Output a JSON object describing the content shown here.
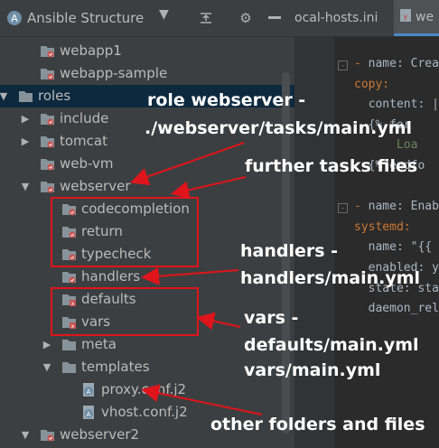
{
  "panel": {
    "title": "Ansible Structure",
    "icons": [
      "ansible-icon",
      "chevron-down-icon",
      "collapse-all-icon",
      "gear-icon",
      "minimize-icon"
    ]
  },
  "tree": [
    {
      "label": "webapp1",
      "depth": 1,
      "arrow": "",
      "icon": "role"
    },
    {
      "label": "webapp-sample",
      "depth": 1,
      "arrow": "",
      "icon": "role"
    },
    {
      "label": "roles",
      "depth": 0,
      "arrow": "down",
      "icon": "folder",
      "selected": true
    },
    {
      "label": "include",
      "depth": 1,
      "arrow": "right",
      "icon": "role"
    },
    {
      "label": "tomcat",
      "depth": 1,
      "arrow": "right",
      "icon": "role"
    },
    {
      "label": "web-vm",
      "depth": 1,
      "arrow": "",
      "icon": "role"
    },
    {
      "label": "webserver",
      "depth": 1,
      "arrow": "down",
      "icon": "role"
    },
    {
      "label": "codecompletion",
      "depth": 2,
      "arrow": "",
      "icon": "task"
    },
    {
      "label": "return",
      "depth": 2,
      "arrow": "",
      "icon": "task"
    },
    {
      "label": "typecheck",
      "depth": 2,
      "arrow": "",
      "icon": "task"
    },
    {
      "label": "handlers",
      "depth": 2,
      "arrow": "",
      "icon": "task"
    },
    {
      "label": "defaults",
      "depth": 2,
      "arrow": "",
      "icon": "vars"
    },
    {
      "label": "vars",
      "depth": 2,
      "arrow": "",
      "icon": "vars"
    },
    {
      "label": "meta",
      "depth": 2,
      "arrow": "right",
      "icon": "folder"
    },
    {
      "label": "templates",
      "depth": 2,
      "arrow": "down",
      "icon": "folder"
    },
    {
      "label": "proxy.conf.j2",
      "depth": 3,
      "arrow": "",
      "icon": "ansible"
    },
    {
      "label": "vhost.conf.j2",
      "depth": 3,
      "arrow": "",
      "icon": "ansible"
    },
    {
      "label": "webserver2",
      "depth": 1,
      "arrow": "down",
      "icon": "role"
    }
  ],
  "tabs": [
    {
      "label": "ocal-hosts.ini",
      "active": false
    },
    {
      "label": "we",
      "active": true
    }
  ],
  "code": [
    {
      "kind": "plain",
      "parts": [
        [
          "k",
          "- "
        ],
        [
          "p",
          "name: Create"
        ]
      ]
    },
    {
      "kind": "plain",
      "parts": [
        [
          "k",
          "copy:"
        ]
      ]
    },
    {
      "kind": "plain",
      "parts": [
        [
          "p",
          "  content: |"
        ]
      ]
    },
    {
      "kind": "plain",
      "parts": [
        [
          "p",
          "  {% for "
        ]
      ]
    },
    {
      "kind": "plain",
      "parts": [
        [
          "s",
          "      Loa"
        ]
      ]
    },
    {
      "kind": "plain",
      "parts": [
        [
          "p",
          "  {% endfo"
        ]
      ]
    },
    {
      "kind": "plain",
      "parts": [
        [
          "p",
          ""
        ]
      ]
    },
    {
      "kind": "plain",
      "parts": [
        [
          "k",
          "- "
        ],
        [
          "p",
          "name: Enable"
        ]
      ]
    },
    {
      "kind": "plain",
      "parts": [
        [
          "k",
          "systemd:"
        ]
      ]
    },
    {
      "kind": "plain",
      "parts": [
        [
          "p",
          "  name: \"{{ "
        ]
      ]
    },
    {
      "kind": "plain",
      "parts": [
        [
          "p",
          "  enabled: y"
        ]
      ]
    },
    {
      "kind": "plain",
      "parts": [
        [
          "p",
          "  state: sta"
        ]
      ]
    },
    {
      "kind": "plain",
      "parts": [
        [
          "p",
          "  daemon_rel"
        ]
      ]
    }
  ],
  "annotations": {
    "n1": "role webserver -",
    "n2": "./webserver/tasks/main.yml",
    "n3": "further tasks files",
    "n4": "handlers -",
    "n5": "handlers/main.yml",
    "n6": "vars -",
    "n7": "defaults/main.yml",
    "n8": "vars/main.yml",
    "n9": "other folders and files"
  },
  "colors": {
    "annotation": "#e0141b",
    "selection": "#0d293e",
    "panel": "#3c3f41",
    "editor": "#2b2b2b"
  }
}
